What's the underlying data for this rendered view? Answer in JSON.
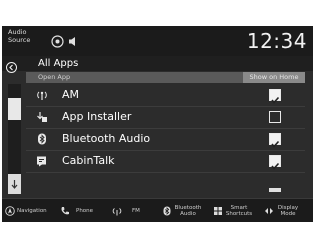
{
  "status_bar": {
    "audio_source": "Audio Source",
    "clock": "12:34",
    "icons": [
      "voice-assist-icon",
      "speaker-icon"
    ]
  },
  "title_row": {
    "back_icon": "back-icon",
    "title": "All Apps"
  },
  "header": {
    "left": "Open App",
    "right": "Show on Home"
  },
  "apps": [
    {
      "icon": "antenna-icon",
      "label": "AM",
      "checked": true
    },
    {
      "icon": "download-icon",
      "label": "App Installer",
      "checked": false
    },
    {
      "icon": "bluetooth-icon",
      "label": "Bluetooth Audio",
      "checked": true
    },
    {
      "icon": "cabintalk-icon",
      "label": "CabinTalk",
      "checked": true
    }
  ],
  "bottom_nav": [
    {
      "icon": "navigation-icon",
      "label": "Navigation"
    },
    {
      "icon": "phone-icon",
      "label": "Phone"
    },
    {
      "icon": "fm-antenna-icon",
      "label": "FM"
    },
    {
      "icon": "bluetooth-icon",
      "label": "Bluetooth Audio"
    },
    {
      "icon": "shortcut-icon",
      "label": "Smart Shortcuts"
    },
    {
      "icon": "display-icon",
      "label": "Display Mode"
    }
  ],
  "colors": {
    "screen_bg": "#2c2c2c",
    "header_bg": "#5a5a5a",
    "text": "#ffffff"
  }
}
